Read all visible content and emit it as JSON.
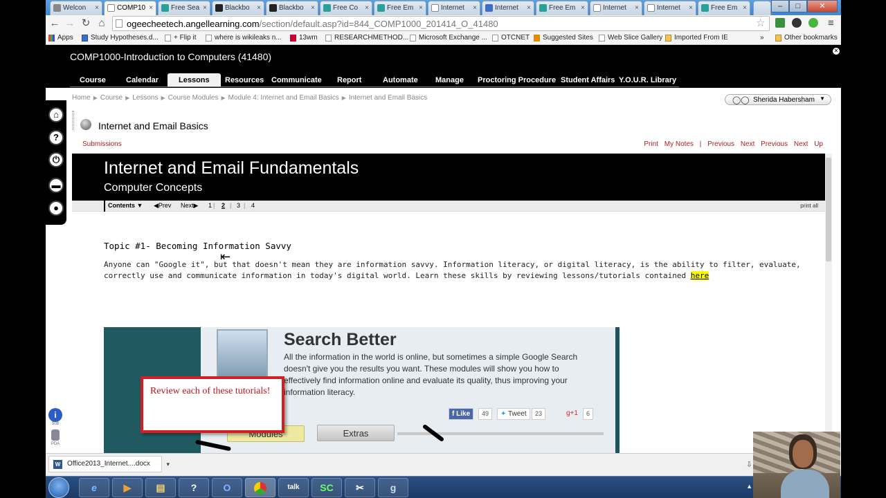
{
  "browser": {
    "tabs": [
      {
        "label": "Welcon"
      },
      {
        "label": "COMP10"
      },
      {
        "label": "Free Sea"
      },
      {
        "label": "Blackbo"
      },
      {
        "label": "Blackbo"
      },
      {
        "label": "Free Co"
      },
      {
        "label": "Free Em"
      },
      {
        "label": "Internet"
      },
      {
        "label": "Internet"
      },
      {
        "label": "Free Em"
      },
      {
        "label": "Internet"
      },
      {
        "label": "Internet"
      },
      {
        "label": "Free Em"
      }
    ],
    "url_host": "ogeecheetech.angellearning.com",
    "url_path": "/section/default.asp?id=844_COMP1000_201414_O_41480",
    "bookmarks": [
      {
        "label": "Apps"
      },
      {
        "label": "Study Hypotheses.d..."
      },
      {
        "label": "+ Flip it"
      },
      {
        "label": "where is wikileaks n..."
      },
      {
        "label": "13wm"
      },
      {
        "label": "RESEARCHMETHOD..."
      },
      {
        "label": "Microsoft Exchange ..."
      },
      {
        "label": "OTCNET"
      },
      {
        "label": "Suggested Sites"
      },
      {
        "label": "Web Slice Gallery"
      },
      {
        "label": "Imported From IE"
      },
      {
        "label": "Other bookmarks"
      }
    ],
    "more_bookmarks": "»"
  },
  "lms": {
    "course_title": "COMP1000-Introduction to Computers (41480)",
    "nav": [
      {
        "label": "Course"
      },
      {
        "label": "Calendar"
      },
      {
        "label": "Lessons"
      },
      {
        "label": "Resources"
      },
      {
        "label": "Communicate"
      },
      {
        "label": "Report"
      },
      {
        "label": "Automate"
      },
      {
        "label": "Manage"
      },
      {
        "label": "Proctoring Procedure"
      },
      {
        "label": "Student Affairs"
      },
      {
        "label": "Y.O.U.R. Library"
      }
    ],
    "breadcrumb": [
      "Home",
      "Course",
      "Lessons",
      "Course Modules",
      "Module 4: Internet and Email Basics",
      "Internet and Email Basics"
    ],
    "user_name": "Sherida Habersham",
    "page_title": "Internet and Email Basics",
    "submissions_label": "Submissions",
    "right_links": {
      "print": "Print",
      "notes": "My Notes",
      "separator": "|",
      "previous1": "Previous",
      "next1": "Next",
      "previous2": "Previous",
      "next2": "Next",
      "up": "Up"
    },
    "left_bar": {
      "info_label": "508",
      "pda_label": "PDA"
    }
  },
  "content": {
    "banner_title": "Internet and Email Fundamentals",
    "banner_subtitle": "Computer Concepts",
    "toc": {
      "contents": "Contents",
      "prev": "Prev",
      "next": "Next",
      "pages": [
        "1",
        "2",
        "3",
        "4"
      ],
      "print_all": "print all"
    },
    "topic_heading": "Topic #1- Becoming Information Savvy",
    "topic_text": "Anyone can \"Google it\", but that doesn't mean they are information savvy. Information literacy, or digital literacy, is the ability to filter, evaluate, correctly use and communicate information in today's digital world. Learn these skills by reviewing lessons/tutorials contained",
    "topic_link": "here",
    "promo": {
      "heading": "Search Better",
      "body": "All the information in the world is online, but sometimes a simple Google Search doesn't give you the results you want. These modules will show you how to effectively find information online and evaluate its quality, thus improving your information literacy.",
      "like_label": "Like",
      "like_count": "49",
      "tweet_label": "Tweet",
      "tweet_count": "23",
      "gplus_label": "g+1",
      "gplus_count": "6",
      "modules_label": "Modules",
      "extras_label": "Extras"
    },
    "callout": "Review each of these tutorials!"
  },
  "downloads": {
    "file": "Office2013_Internet....docx"
  }
}
